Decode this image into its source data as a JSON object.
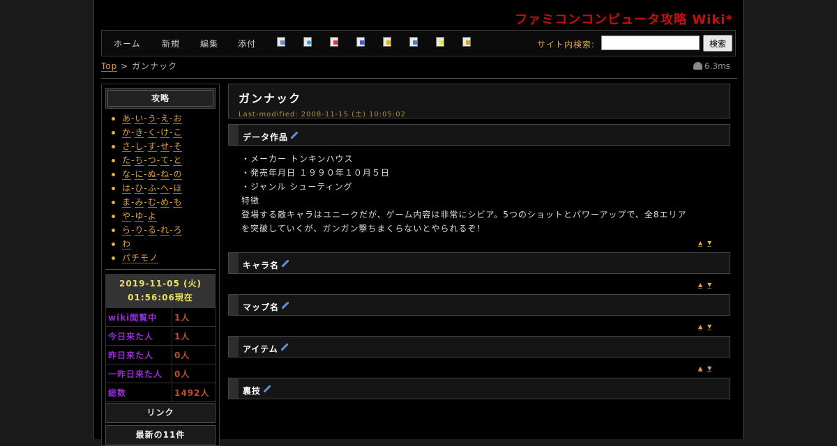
{
  "site_title": "ファミコンコンピュータ攻略 Wiki*",
  "nav": {
    "links": [
      "ホーム",
      "新規",
      "編集",
      "添付"
    ],
    "icons": [
      "list-page-icon",
      "search-page-icon",
      "diff-icon",
      "backup-icon",
      "attach-file-icon",
      "copy-page-icon",
      "rename-icon",
      "help-icon"
    ],
    "search_label": "サイト内検索:",
    "search_value": "",
    "search_button": "検索"
  },
  "breadcrumb": {
    "top": "Top",
    "sep": ">",
    "current": "ガンナック"
  },
  "timing": "6.3ms",
  "sidebar": {
    "heading": "攻略",
    "kana": [
      [
        "あ",
        "い",
        "う",
        "え",
        "お"
      ],
      [
        "か",
        "き",
        "く",
        "け",
        "こ"
      ],
      [
        "さ",
        "し",
        "す",
        "せ",
        "そ"
      ],
      [
        "た",
        "ち",
        "つ",
        "て",
        "と"
      ],
      [
        "な",
        "に",
        "ぬ",
        "ね",
        "の"
      ],
      [
        "は",
        "ひ",
        "ふ",
        "へ",
        "ほ"
      ],
      [
        "ま",
        "み",
        "む",
        "め",
        "も"
      ],
      [
        "や",
        "ゆ",
        "よ"
      ],
      [
        "ら",
        "り",
        "る",
        "れ",
        "ろ"
      ],
      [
        "わ"
      ],
      [
        "パチモノ"
      ]
    ],
    "date_now": "2019-11-05 (火) 01:56:06現在",
    "counter": [
      {
        "label": "wiki閲覧中",
        "value": "1人"
      },
      {
        "label": "今日来た人",
        "value": "1人"
      },
      {
        "label": "昨日来た人",
        "value": "0人"
      },
      {
        "label": "一昨日来た人",
        "value": "0人"
      },
      {
        "label": "総数",
        "value": "1492人"
      }
    ],
    "links_heading": "リンク",
    "recent_heading": "最新の11件"
  },
  "page": {
    "title": "ガンナック",
    "modified": "Last-modified: 2008-11-15 (土) 10:05:02",
    "sections": [
      {
        "title": "データ作品"
      },
      {
        "title": "キャラ名"
      },
      {
        "title": "マップ名"
      },
      {
        "title": "アイテム"
      },
      {
        "title": "裏技"
      }
    ],
    "data_lines": [
      "・メーカー トンキンハウス",
      "・発売年月日 １９９０年１０月５日",
      "・ジャンル シューティング",
      "特徴",
      "登場する敵キャラはユニークだが、ゲーム内容は非常にシビア。5つのショットとパワーアップで、全8エリア",
      "を突破していくが、ガンガン撃ちまくらないとやられるぞ！"
    ],
    "up_arrow": "▲",
    "down_arrow": "▼"
  }
}
